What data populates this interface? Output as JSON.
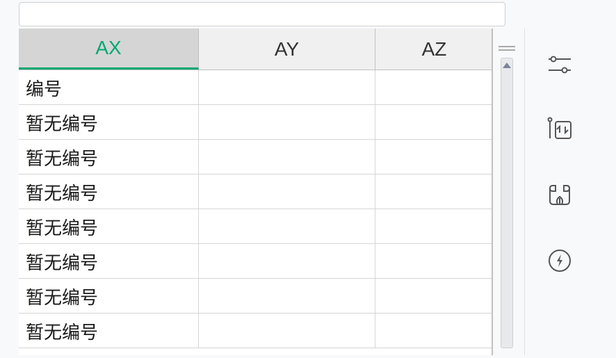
{
  "columns": {
    "ax": "AX",
    "ay": "AY",
    "az": "AZ"
  },
  "rows": [
    {
      "ax": "编号",
      "ay": "",
      "az": ""
    },
    {
      "ax": "暂无编号",
      "ay": "",
      "az": ""
    },
    {
      "ax": "暂无编号",
      "ay": "",
      "az": ""
    },
    {
      "ax": "暂无编号",
      "ay": "",
      "az": ""
    },
    {
      "ax": "暂无编号",
      "ay": "",
      "az": ""
    },
    {
      "ax": "暂无编号",
      "ay": "",
      "az": ""
    },
    {
      "ax": "暂无编号",
      "ay": "",
      "az": ""
    },
    {
      "ax": "暂无编号",
      "ay": "",
      "az": ""
    }
  ],
  "sidebar": {
    "icons": [
      "settings-sliders",
      "column-swap",
      "eco-data",
      "lightning-tip"
    ]
  }
}
